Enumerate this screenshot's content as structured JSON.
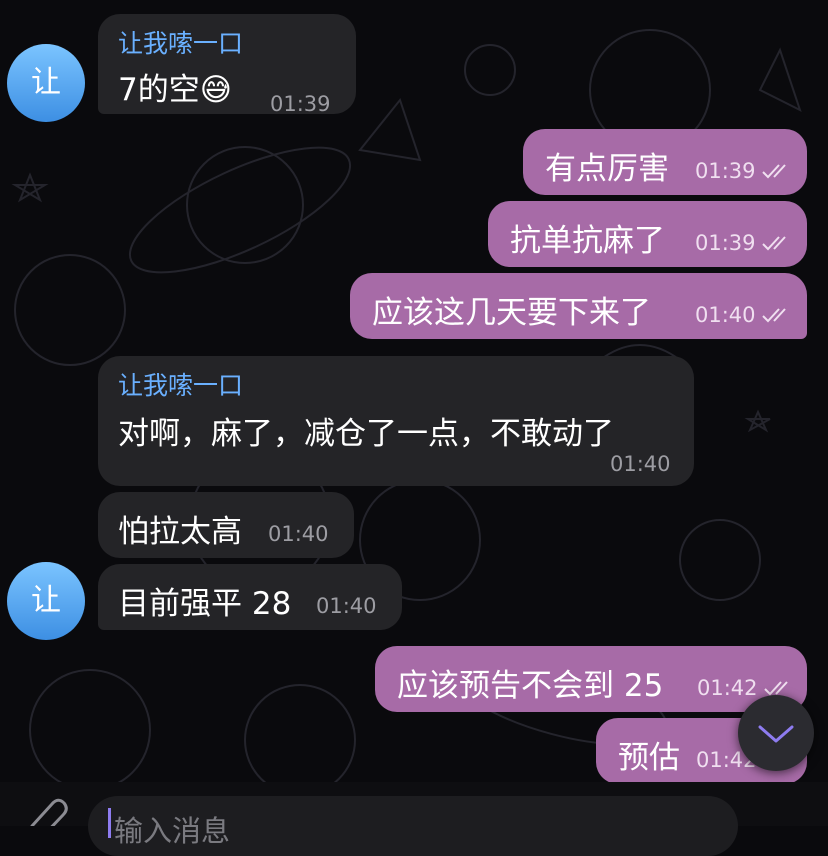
{
  "chat": {
    "sender_name": "让我嗦一口",
    "avatar_initial": "让",
    "messages": [
      {
        "dir": "in",
        "text": "7的空😅",
        "time": "01:39"
      },
      {
        "dir": "out",
        "text": "有点厉害",
        "time": "01:39"
      },
      {
        "dir": "out",
        "text": "抗单抗麻了",
        "time": "01:39"
      },
      {
        "dir": "out",
        "text": "应该这几天要下来了",
        "time": "01:40"
      },
      {
        "dir": "in",
        "text": "对啊，麻了，减仓了一点，不敢动了",
        "time": "01:40"
      },
      {
        "dir": "in",
        "text": "怕拉太高",
        "time": "01:40"
      },
      {
        "dir": "in",
        "text": "目前强平 28",
        "time": "01:40"
      },
      {
        "dir": "out",
        "text": "应该预告不会到 25",
        "time": "01:42"
      },
      {
        "dir": "out",
        "text": "预估",
        "time": "01:42"
      }
    ]
  },
  "composer": {
    "placeholder": "输入消息"
  },
  "icons": {
    "attach": "paperclip-icon",
    "scroll_down": "chevron-down-icon",
    "read_receipt": "double-check-icon"
  },
  "colors": {
    "incoming_bubble": "#242427",
    "outgoing_bubble": "#a76ba7",
    "sender_name": "#6ab0ff",
    "avatar": "#5aa8f5"
  }
}
